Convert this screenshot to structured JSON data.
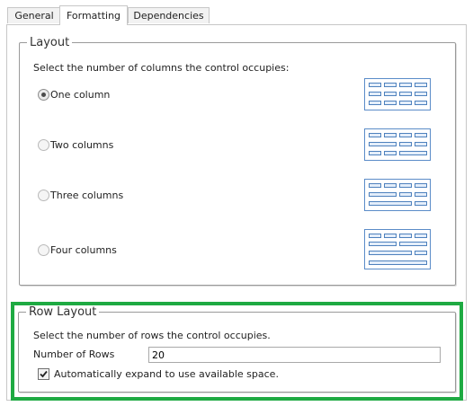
{
  "tabs": [
    {
      "label": "General",
      "active": false
    },
    {
      "label": "Formatting",
      "active": true
    },
    {
      "label": "Dependencies",
      "active": false
    }
  ],
  "layout": {
    "legend": "Layout",
    "description": "Select the number of columns the control occupies:",
    "options": [
      {
        "label": "One column",
        "checked": true
      },
      {
        "label": "Two columns",
        "checked": false
      },
      {
        "label": "Three columns",
        "checked": false
      },
      {
        "label": "Four columns",
        "checked": false
      }
    ]
  },
  "row_layout": {
    "legend": "Row Layout",
    "description": "Select the number of rows the control occupies.",
    "rows_label": "Number of Rows",
    "rows_value": "20",
    "auto_expand_label": "Automatically expand to use available space.",
    "auto_expand_checked": true
  },
  "colors": {
    "highlight": "#1eaa42",
    "preview_border": "#4e81bd",
    "preview_fill": "#e4eefa"
  },
  "icons": [
    "layout-one-column-icon",
    "layout-two-columns-icon",
    "layout-three-columns-icon",
    "layout-four-columns-icon",
    "checkmark-icon"
  ]
}
